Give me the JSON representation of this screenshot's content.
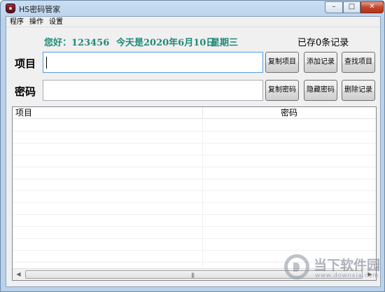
{
  "window": {
    "title": "HS密码管家",
    "controls": {
      "minimize": "–",
      "maximize": "□",
      "close": "✕"
    }
  },
  "menu": {
    "items": [
      "程序",
      "操作",
      "设置"
    ]
  },
  "info": {
    "greeting": "您好：123456",
    "date": "今天是2020年6月10日",
    "weekday": "星期三",
    "record_count": "已存0条记录"
  },
  "form": {
    "item_label": "项目",
    "password_label": "密码",
    "item_value": "",
    "password_value": ""
  },
  "buttons": {
    "copy_item": "复制项目",
    "add_record": "添加记录",
    "find_item": "查找项目",
    "copy_password": "复制密码",
    "hide_password": "隐藏密码",
    "delete_record": "删除记录"
  },
  "table": {
    "columns": [
      "项目",
      "密码"
    ],
    "rows": []
  },
  "scrollbar": {
    "grip": "|||"
  },
  "watermark": {
    "text": "当下软件园",
    "url": "www.downxia.com"
  },
  "colors": {
    "greeting": "#1f8a78",
    "title_bar": "#b9d1ea",
    "close_button": "#c2452b"
  }
}
